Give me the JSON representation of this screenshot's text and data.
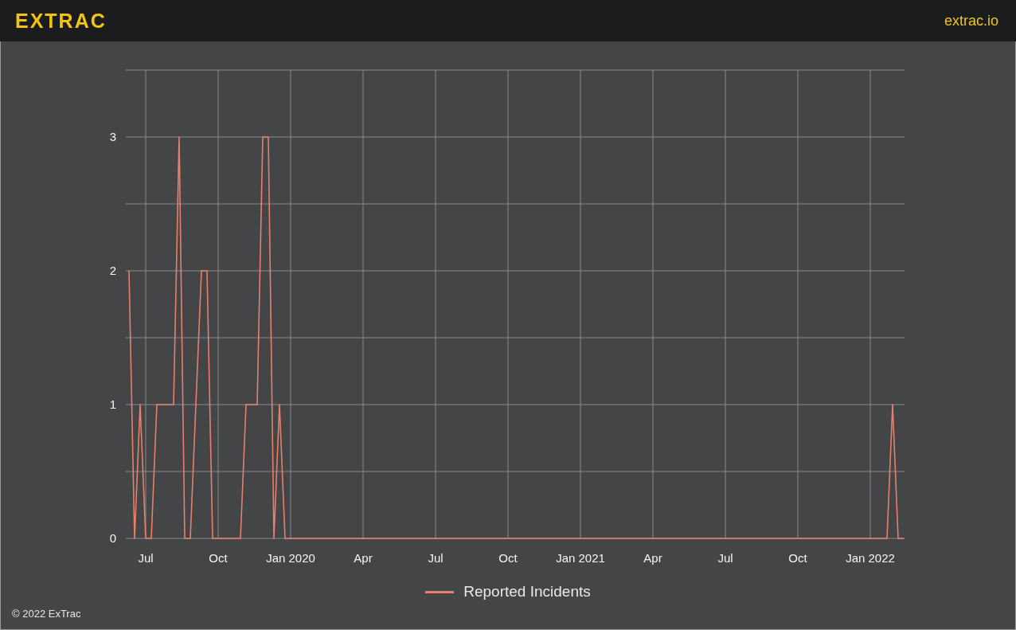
{
  "header": {
    "logo": "EXTRAC",
    "link": "extrac.io"
  },
  "chart_data": {
    "type": "line",
    "grid": true,
    "ylim": [
      0,
      3.5
    ],
    "yticks": [
      0,
      1,
      2,
      3
    ],
    "categories": [
      null,
      null,
      null,
      "Jul",
      null,
      null,
      null,
      null,
      null,
      null,
      null,
      null,
      null,
      null,
      null,
      null,
      "Oct",
      null,
      null,
      null,
      null,
      null,
      null,
      null,
      null,
      null,
      null,
      null,
      null,
      "Jan 2020",
      null,
      null,
      null,
      null,
      null,
      null,
      null,
      null,
      null,
      null,
      null,
      null,
      "Apr",
      null,
      null,
      null,
      null,
      null,
      null,
      null,
      null,
      null,
      null,
      null,
      null,
      "Jul",
      null,
      null,
      null,
      null,
      null,
      null,
      null,
      null,
      null,
      null,
      null,
      null,
      "Oct",
      null,
      null,
      null,
      null,
      null,
      null,
      null,
      null,
      null,
      null,
      null,
      null,
      "Jan 2021",
      null,
      null,
      null,
      null,
      null,
      null,
      null,
      null,
      null,
      null,
      null,
      null,
      "Apr",
      null,
      null,
      null,
      null,
      null,
      null,
      null,
      null,
      null,
      null,
      null,
      null,
      "Jul",
      null,
      null,
      null,
      null,
      null,
      null,
      null,
      null,
      null,
      null,
      null,
      null,
      "Oct",
      null,
      null,
      null,
      null,
      null,
      null,
      null,
      null,
      null,
      null,
      null,
      null,
      "Jan 2022",
      null,
      null,
      null,
      null,
      null,
      null
    ],
    "series": [
      {
        "name": "Reported Incidents",
        "color": "#e8806c",
        "values": [
          2,
          0,
          1,
          0,
          0,
          1,
          1,
          1,
          1,
          3,
          0,
          0,
          1,
          2,
          2,
          0,
          0,
          0,
          0,
          0,
          0,
          1,
          1,
          1,
          3,
          3,
          0,
          1,
          0,
          0,
          0,
          0,
          0,
          0,
          0,
          0,
          0,
          0,
          0,
          0,
          0,
          0,
          0,
          0,
          0,
          0,
          0,
          0,
          0,
          0,
          0,
          0,
          0,
          0,
          0,
          0,
          0,
          0,
          0,
          0,
          0,
          0,
          0,
          0,
          0,
          0,
          0,
          0,
          0,
          0,
          0,
          0,
          0,
          0,
          0,
          0,
          0,
          0,
          0,
          0,
          0,
          0,
          0,
          0,
          0,
          0,
          0,
          0,
          0,
          0,
          0,
          0,
          0,
          0,
          0,
          0,
          0,
          0,
          0,
          0,
          0,
          0,
          0,
          0,
          0,
          0,
          0,
          0,
          0,
          0,
          0,
          0,
          0,
          0,
          0,
          0,
          0,
          0,
          0,
          0,
          0,
          0,
          0,
          0,
          0,
          0,
          0,
          0,
          0,
          0,
          0,
          0,
          0,
          0,
          0,
          0,
          0,
          1,
          0,
          0
        ]
      }
    ]
  },
  "footer": "© 2022 ExTrac"
}
